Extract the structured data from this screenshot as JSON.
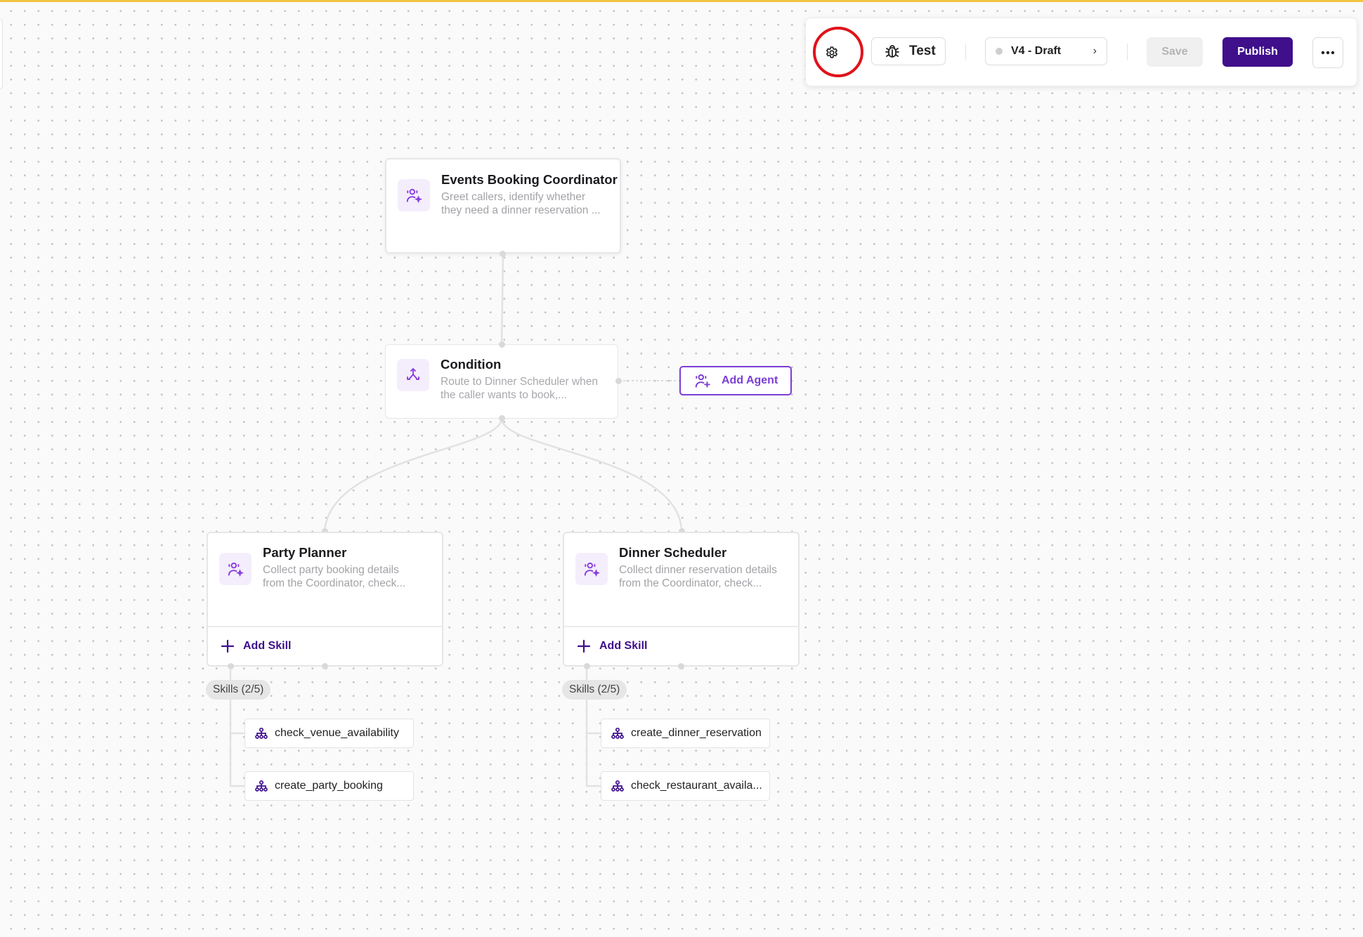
{
  "toolbar": {
    "test_label": "Test",
    "version_label": "V4 - Draft",
    "version_chevron": "›",
    "save_label": "Save",
    "publish_label": "Publish"
  },
  "nodes": {
    "coordinator": {
      "title": "Events Booking Coordinator",
      "desc_line1": "Greet callers, identify whether",
      "desc_line2": "they need a dinner reservation ..."
    },
    "condition": {
      "title": "Condition",
      "desc_line1": "Route to Dinner Scheduler when",
      "desc_line2": "the caller wants to book,..."
    },
    "party_planner": {
      "title": "Party Planner",
      "desc_line1": "Collect party booking details",
      "desc_line2": "from the Coordinator, check...",
      "add_skill_label": "Add Skill",
      "skills_badge": "Skills (2/5)",
      "skills": [
        "check_venue_availability",
        "create_party_booking"
      ]
    },
    "dinner_scheduler": {
      "title": "Dinner Scheduler",
      "desc_line1": "Collect dinner reservation details",
      "desc_line2": "from the Coordinator, check...",
      "add_skill_label": "Add Skill",
      "skills_badge": "Skills (2/5)",
      "skills": [
        "create_dinner_reservation",
        "check_restaurant_availa..."
      ]
    }
  },
  "add_agent_label": "Add Agent",
  "colors": {
    "accent_purple": "#7c3dd4",
    "publish_bg": "#3f0f8c",
    "top_accent": "#f4c542",
    "highlight_ring": "#e0121b"
  },
  "icons": {
    "settings": "gear-icon",
    "test": "bug-icon",
    "more": "ellipsis-icon",
    "agent": "agent-sparkle-icon",
    "condition": "branch-icon",
    "add": "plus-icon",
    "add_agent": "user-plus-icon",
    "skill": "hierarchy-icon"
  }
}
